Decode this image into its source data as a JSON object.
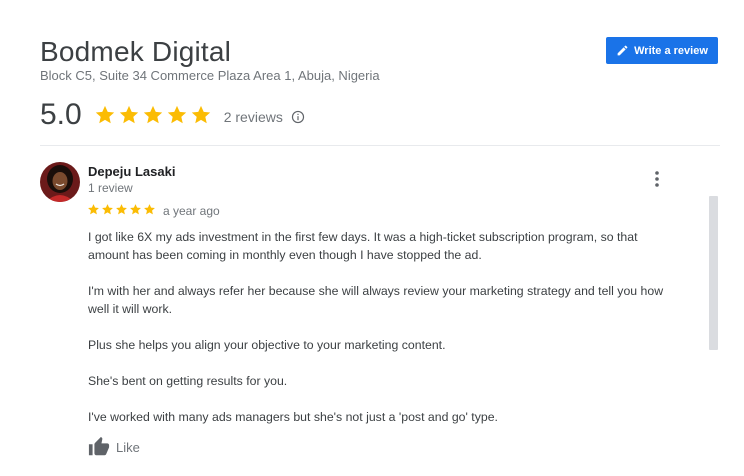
{
  "business": {
    "name": "Bodmek Digital",
    "address": "Block C5, Suite 34 Commerce Plaza Area 1, Abuja, Nigeria"
  },
  "write_review_label": "Write a review",
  "rating": {
    "value": "5.0",
    "stars": 5,
    "review_count": "2 reviews"
  },
  "review": {
    "reviewer_name": "Depeju Lasaki",
    "reviewer_reviews": "1 review",
    "stars": 5,
    "date": "a year ago",
    "paragraphs": [
      "I got like 6X my ads investment in the first few days. It was a high-ticket subscription program, so that amount has been coming in monthly even though I have stopped the ad.",
      "I'm with her and always refer her because she will always review your marketing strategy and tell you how well it will work.",
      "Plus she helps you align your objective to your marketing content.",
      "She's bent on getting results for you.",
      "I've worked with many ads managers but she's not just a 'post and go' type."
    ],
    "like_label": "Like"
  },
  "colors": {
    "star": "#fbbc04",
    "button": "#1a73e8"
  }
}
